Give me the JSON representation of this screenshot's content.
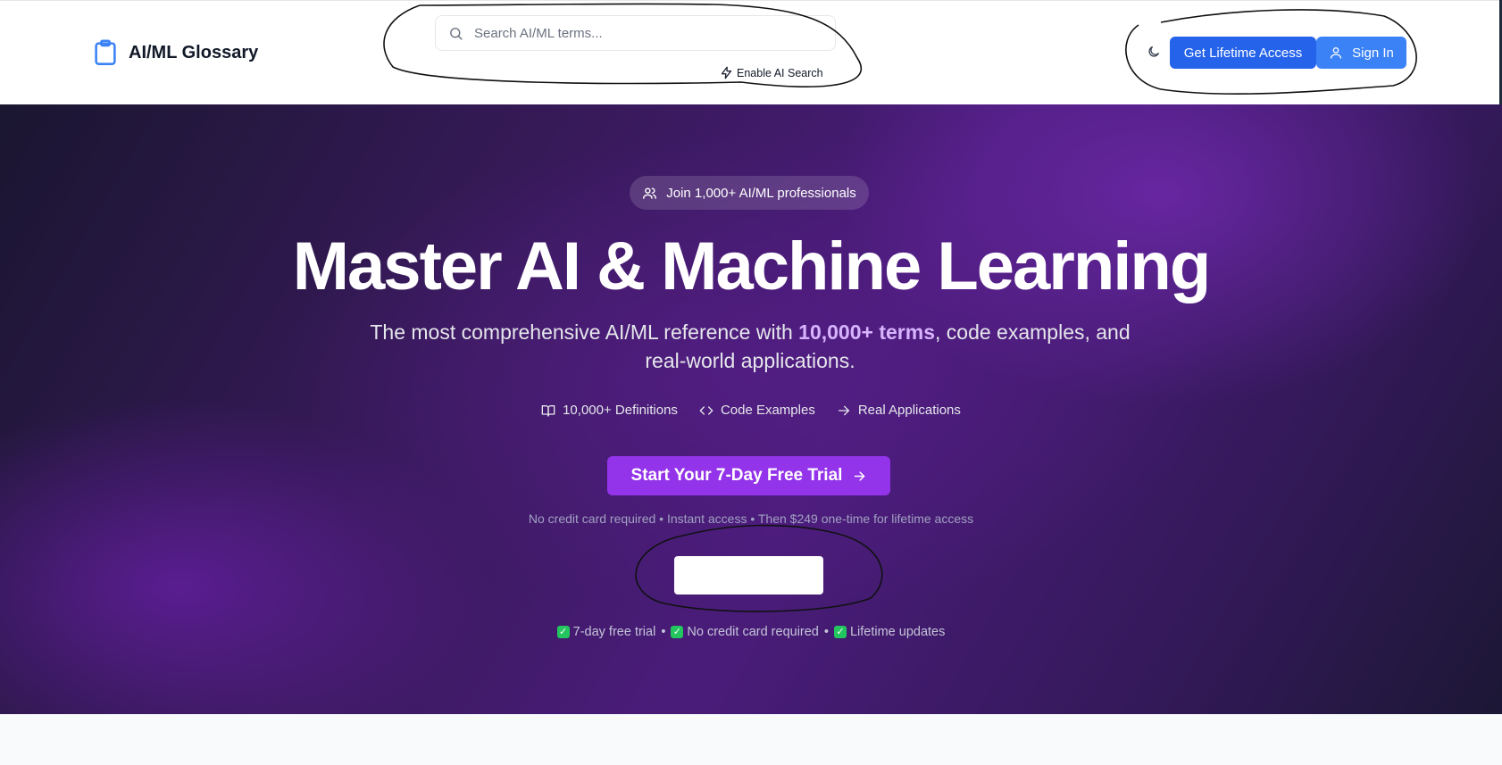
{
  "header": {
    "logo_text": "AI/ML Glossary",
    "search_placeholder": "Search AI/ML terms...",
    "ai_search_label": "Enable AI Search",
    "lifetime_button": "Get Lifetime Access",
    "signin_button": "Sign In"
  },
  "hero": {
    "badge": "Join 1,000+ AI/ML professionals",
    "headline": "Master AI & Machine Learning",
    "subline_before": "The most comprehensive AI/ML reference with ",
    "subline_highlight": "10,000+ terms",
    "subline_after": ", code examples, and real-world applications.",
    "features": [
      {
        "icon": "book-open-icon",
        "label": "10,000+ Definitions"
      },
      {
        "icon": "code-icon",
        "label": "Code Examples"
      },
      {
        "icon": "arrow-right-icon",
        "label": "Real Applications"
      }
    ],
    "cta_label": "Start Your 7-Day Free Trial",
    "fineprint": "No credit card required • Instant access • Then $249 one-time for lifetime access",
    "checks": [
      "7-day free trial",
      "No credit card required",
      "Lifetime updates"
    ],
    "check_separator": "•"
  },
  "colors": {
    "primary_blue": "#2563eb",
    "signin_blue": "#3b82f6",
    "cta_purple": "#9333ea",
    "highlight_lavender": "#d8b4fe"
  }
}
